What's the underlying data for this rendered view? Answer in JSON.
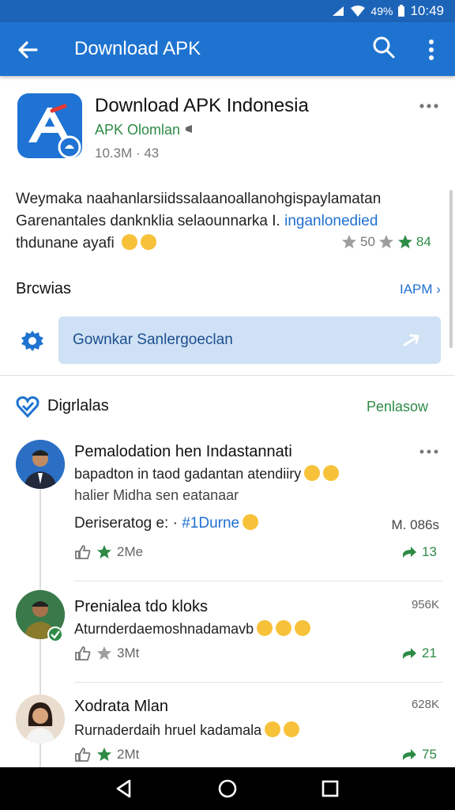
{
  "status": {
    "battery": "49%",
    "time": "10:49"
  },
  "appbar": {
    "title": "Download APK"
  },
  "app": {
    "name": "Download APK Indonesia",
    "developer": "APK Olomlan",
    "meta": "10.3M · 43"
  },
  "description": {
    "line1": "Weymaka naahanlarsiidssalaanoallanohgispaylamatan",
    "line2_a": "Garenantales danknklia selaounnarka I. ",
    "line2_link": "inganlonedied",
    "line3": "thdunane ayafi"
  },
  "rating": {
    "value1": "50",
    "value2": "84"
  },
  "browse": {
    "title": "Brcwias",
    "link": "IAPM",
    "button_label": "Gownkar Sanlergoeclan"
  },
  "feed": {
    "title": "Digrlalas",
    "link": "Penlasow",
    "posts": [
      {
        "title": "Pemalodation hen Indastannati",
        "line1": "bapadton in taod gadantan atendiiry",
        "line2": "halier  Midha sen eatanaar",
        "detail_label": "Deriseratog e: ·",
        "detail_tag": "#1Durne",
        "detail_right": "M. 086s",
        "likes": "2Me",
        "shares": "13"
      },
      {
        "title": "Prenialea tdo kloks",
        "line1": "Aturnderdaemoshnadamavb",
        "count": "956K",
        "likes": "3Mt",
        "shares": "21"
      },
      {
        "title": "Xodrata Mlan",
        "line1": "Rurnaderdaih hruel kadamala",
        "count": "628K",
        "likes": "2Mt",
        "shares": "75"
      }
    ]
  },
  "colors": {
    "appbar": "#1f73d0",
    "statusbar": "#1c64b8",
    "accent_green": "#2e8b46",
    "button_bg": "#cfe1f5"
  }
}
